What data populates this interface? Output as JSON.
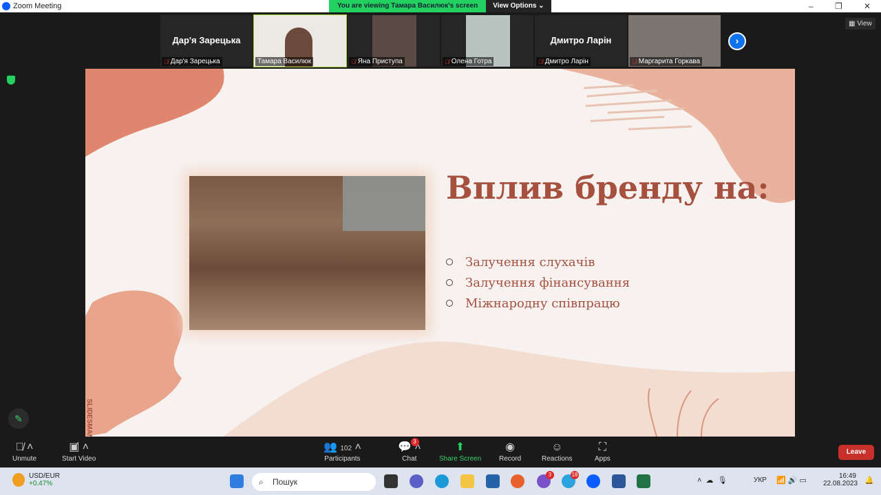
{
  "window": {
    "title": "Zoom Meeting",
    "banner": "You are viewing Тамара Василюк's screen",
    "view_options": "View Options",
    "minimize": "–",
    "maximize": "❐",
    "close": "✕"
  },
  "gallery": {
    "view_label": "View",
    "next_icon": "›",
    "participants": [
      {
        "name": "Дар'я Зарецька",
        "big": "Дар'я Зарецька",
        "video": false,
        "muted": true
      },
      {
        "name": "Тамара Василюк",
        "video": true,
        "muted": false,
        "active": true
      },
      {
        "name": "Яна Приступа",
        "video": true,
        "muted": true
      },
      {
        "name": "Олена Готра",
        "video": true,
        "muted": true
      },
      {
        "name": "Дмитро Ларін",
        "big": "Дмитро Ларін",
        "video": false,
        "muted": true
      },
      {
        "name": "Маргарита Горкава",
        "video": true,
        "muted": true
      }
    ]
  },
  "slide": {
    "title": "Вплив бренду на:",
    "bullets": [
      "Залучення слухачів",
      "Залучення фінансування",
      "Міжнародну співпрацю"
    ],
    "watermark": "SLIDESMANIA",
    "colors": {
      "title": "#a6503f",
      "blob1": "#e0866e",
      "blob2": "#e9b29c",
      "blob3": "#f3ddd1"
    }
  },
  "toolbar": {
    "unmute": "Unmute",
    "start_video": "Start Video",
    "participants": "Participants",
    "participants_count": "102",
    "chat": "Chat",
    "chat_badge": "3",
    "share": "Share Screen",
    "record": "Record",
    "reactions": "Reactions",
    "apps": "Apps",
    "leave": "Leave"
  },
  "taskbar": {
    "ticker": "USD/EUR",
    "ticker_change": "+0.47%",
    "search_placeholder": "Пошук",
    "viber_badge": "3",
    "telegram_badge": "18",
    "lang": "УКР",
    "time": "16:49",
    "date": "22.08.2023"
  }
}
